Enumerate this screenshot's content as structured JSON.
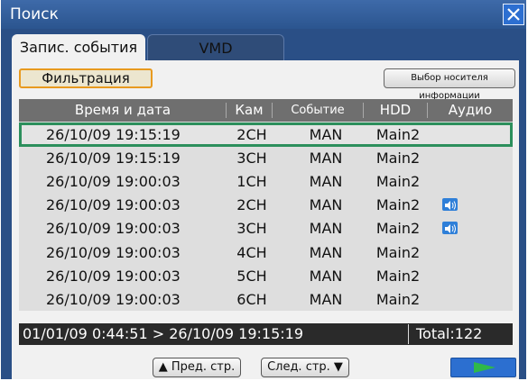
{
  "window": {
    "title": "Поиск"
  },
  "tabs": [
    {
      "label": "Запис. события",
      "active": true
    },
    {
      "label": "VMD",
      "active": false
    }
  ],
  "toolbar": {
    "filter_label": "Фильтрация",
    "media_label": "Выбор носителя информации"
  },
  "table": {
    "columns": [
      "Время и дата",
      "Кам",
      "Событие",
      "HDD",
      "Аудио"
    ],
    "rows": [
      {
        "time": "26/10/09 19:15:19",
        "cam": "2CH",
        "event": "MAN",
        "hdd": "Main2",
        "audio": false,
        "selected": true
      },
      {
        "time": "26/10/09 19:15:19",
        "cam": "3CH",
        "event": "MAN",
        "hdd": "Main2",
        "audio": false,
        "selected": false
      },
      {
        "time": "26/10/09 19:00:03",
        "cam": "1CH",
        "event": "MAN",
        "hdd": "Main2",
        "audio": false,
        "selected": false
      },
      {
        "time": "26/10/09 19:00:03",
        "cam": "2CH",
        "event": "MAN",
        "hdd": "Main2",
        "audio": true,
        "selected": false
      },
      {
        "time": "26/10/09 19:00:03",
        "cam": "3CH",
        "event": "MAN",
        "hdd": "Main2",
        "audio": true,
        "selected": false
      },
      {
        "time": "26/10/09 19:00:03",
        "cam": "4CH",
        "event": "MAN",
        "hdd": "Main2",
        "audio": false,
        "selected": false
      },
      {
        "time": "26/10/09 19:00:03",
        "cam": "5CH",
        "event": "MAN",
        "hdd": "Main2",
        "audio": false,
        "selected": false
      },
      {
        "time": "26/10/09 19:00:03",
        "cam": "6CH",
        "event": "MAN",
        "hdd": "Main2",
        "audio": false,
        "selected": false
      }
    ]
  },
  "status": {
    "range": "01/01/09  0:44:51 > 26/10/09 19:15:19",
    "total": "Total:122"
  },
  "nav": {
    "prev_label": "▲ Пред. стр.",
    "next_label": "След. стр. ▼"
  },
  "colors": {
    "accent": "#e89a1f",
    "selection": "#2c8f5c",
    "window_bg": "#2a4f86",
    "play": "#2fb84a"
  },
  "icons": {
    "close": "close-icon",
    "audio": "speaker-icon",
    "play": "play-icon"
  }
}
